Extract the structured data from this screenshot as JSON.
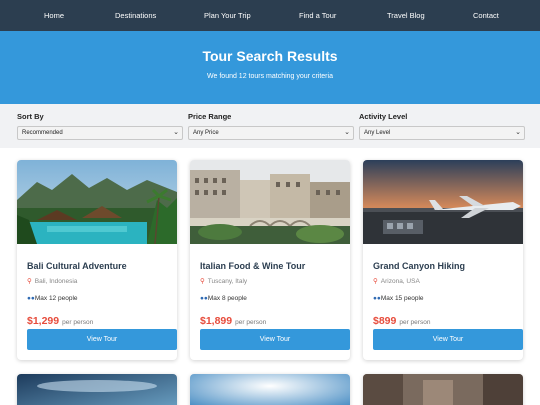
{
  "nav": {
    "items": [
      "Home",
      "Destinations",
      "Plan Your Trip",
      "Find a Tour",
      "Travel Blog",
      "Contact"
    ]
  },
  "hero": {
    "title": "Tour Search Results",
    "subtitle": "We found 12 tours matching your criteria"
  },
  "filters": {
    "sort": {
      "label": "Sort By",
      "value": "Recommended"
    },
    "price": {
      "label": "Price Range",
      "value": "Any Price"
    },
    "activity": {
      "label": "Activity Level",
      "value": "Any Level"
    }
  },
  "tours": [
    {
      "title": "Bali Cultural Adventure",
      "location": "Bali, Indonesia",
      "group": "Max 12 people",
      "price": "$1,299",
      "per": "per person",
      "button": "View Tour"
    },
    {
      "title": "Italian Food & Wine Tour",
      "location": "Tuscany, Italy",
      "group": "Max 8 people",
      "price": "$1,899",
      "per": "per person",
      "button": "View Tour"
    },
    {
      "title": "Grand Canyon Hiking",
      "location": "Arizona, USA",
      "group": "Max 15 people",
      "price": "$899",
      "per": "per person",
      "button": "View Tour"
    }
  ],
  "colors": {
    "nav": "#2c3e50",
    "accent": "#3498db",
    "price": "#e74c3c"
  },
  "icons": {
    "location": "map-pin-icon",
    "group": "people-icon",
    "dropdown": "chevron-down-icon"
  }
}
